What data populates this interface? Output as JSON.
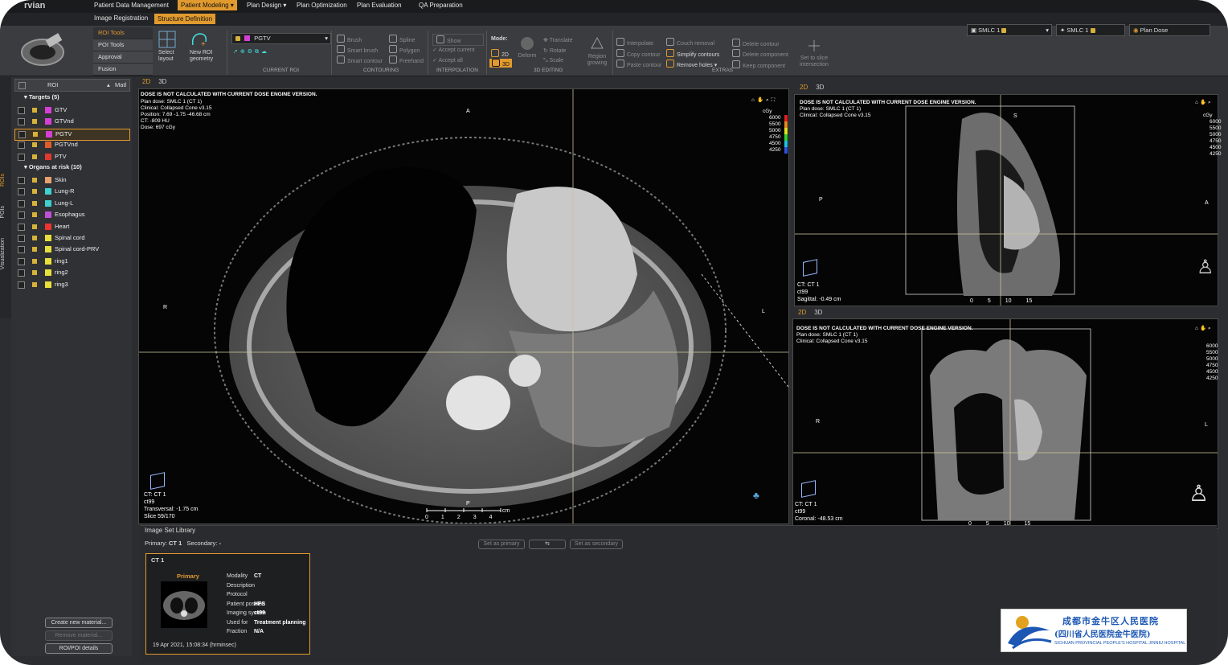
{
  "app": {
    "brand": "rvian"
  },
  "menu": {
    "tabs": [
      "Patient Data Management",
      "Patient Modeling ▾",
      "Plan Design ▾",
      "Plan Optimization",
      "Plan Evaluation",
      "QA Preparation"
    ]
  },
  "submenu": {
    "tabs": [
      "Image Registration",
      "Structure Definition"
    ]
  },
  "ribbon": {
    "side_menu": [
      "ROI Tools",
      "POI Tools",
      "Approval",
      "Fusion"
    ],
    "select_layout": "Select layout",
    "new_roi": "New ROI geometry",
    "current_roi": {
      "name": "PGTV",
      "color": "#d53fd5",
      "group_label": "CURRENT ROI"
    },
    "contouring": {
      "tools": [
        "Brush",
        "Smart brush",
        "Smart contour",
        "Spline",
        "Polygon",
        "Freehand"
      ],
      "group_label": "CONTOURING"
    },
    "interpolation": {
      "show": "Show",
      "accept_current": "Accept current",
      "accept_all": "Accept all",
      "group_label": "INTERPOLATION"
    },
    "mode": {
      "label": "Mode:",
      "options": [
        "2D",
        "3D"
      ]
    },
    "editing_3d": {
      "deform": "Deform",
      "translate": "Translate",
      "rotate": "Rotate",
      "scale": "Scale",
      "region_growing": "Region growing",
      "group_label": "3D EDITING"
    },
    "extras": {
      "interpolate": "Interpolate",
      "copy_contour": "Copy contour",
      "paste_contour": "Paste contour",
      "couch_removal": "Couch removal",
      "simplify_contours": "Simplify contours",
      "remove_holes": "Remove holes ▾",
      "delete_contour": "Delete contour",
      "delete_component": "Delete component",
      "keep_component": "Keep component",
      "set_to_slice": "Set to slice intersection",
      "group_label": "EXTRAS"
    },
    "status": {
      "plan1": "SMLC 1",
      "plan2": "SMLC 1",
      "plan_dose": "Plan Dose"
    }
  },
  "left_panel": {
    "vtabs": [
      "ROIs",
      "POIs",
      "Visualization"
    ],
    "header": {
      "roi": "ROI",
      "matl": "Matl"
    },
    "groups": [
      {
        "label": "Targets (5)",
        "items": [
          {
            "name": "GTV",
            "color": "#d53fd5"
          },
          {
            "name": "GTVnd",
            "color": "#d53fd5"
          },
          {
            "name": "PGTV",
            "color": "#d53fd5",
            "selected": true
          },
          {
            "name": "PGTVnd",
            "color": "#e25c2b"
          },
          {
            "name": "PTV",
            "color": "#e03a2f"
          }
        ]
      },
      {
        "label": "Organs at risk (10)",
        "items": [
          {
            "name": "Skin",
            "color": "#e8a070"
          },
          {
            "name": "Lung-R",
            "color": "#3fd0d0"
          },
          {
            "name": "Lung-L",
            "color": "#3fd0d0"
          },
          {
            "name": "Esophagus",
            "color": "#c04fd8"
          },
          {
            "name": "Heart",
            "color": "#e33"
          },
          {
            "name": "Spinal cord",
            "color": "#e8e03a"
          },
          {
            "name": "Spinal cord-PRV",
            "color": "#e8e03a"
          },
          {
            "name": "ring1",
            "color": "#e8e03a"
          },
          {
            "name": "ring2",
            "color": "#e8e03a"
          },
          {
            "name": "ring3",
            "color": "#e8e03a"
          }
        ]
      }
    ],
    "buttons": [
      "Create new material...",
      "Remove material...",
      "ROI/POI details"
    ]
  },
  "viewports": {
    "tabs": [
      "2D",
      "3D"
    ],
    "main": {
      "warning": "DOSE IS NOT CALCULATED WITH CURRENT DOSE ENGINE VERSION.",
      "lines": [
        "Plan dose: SMLC 1 (CT 1)",
        "Clinical: Collapsed Cone v3.15",
        "Position: 7.69 -1.75 -46.68 cm",
        "CT: -809 HU",
        "Dose: 697 cGy"
      ],
      "bottom": [
        "CT: CT 1",
        "ct99",
        "Transversal: -1.75 cm",
        "Slice 59/170"
      ],
      "orient": {
        "top": "A",
        "bottom": "P",
        "left": "R",
        "right": "L"
      },
      "scale": [
        "0",
        "1",
        "2",
        "3",
        "4"
      ],
      "scale_unit": "cm"
    },
    "sagittal": {
      "warning": "DOSE IS NOT CALCULATED WITH CURRENT DOSE ENGINE VERSION.",
      "lines": [
        "Plan dose: SMLC 1 (CT 1)",
        "Clinical: Collapsed Cone v3.15"
      ],
      "bottom": [
        "CT: CT 1",
        "ct99",
        "Sagittal: -0.49 cm"
      ],
      "orient": {
        "left": "P",
        "right": "A",
        "top": "S"
      },
      "scale": [
        "0",
        "5",
        "10",
        "15"
      ]
    },
    "coronal": {
      "warning": "DOSE IS NOT CALCULATED WITH CURRENT DOSE ENGINE VERSION.",
      "lines": [
        "Plan dose: SMLC 1 (CT 1)",
        "Clinical: Collapsed Cone v3.15"
      ],
      "bottom": [
        "CT: CT 1",
        "ct99",
        "Coronal: -48.53 cm"
      ],
      "orient": {
        "left": "R",
        "right": "L"
      },
      "scale": [
        "0",
        "5",
        "10",
        "15"
      ]
    },
    "colorbar": {
      "unit": "cGy",
      "levels": [
        "6000",
        "5500",
        "5000",
        "4750",
        "4500",
        "4250"
      ],
      "colors": [
        "#e02020",
        "#e08a20",
        "#e0e020",
        "#30d030",
        "#20c0e0",
        "#3050e0"
      ]
    }
  },
  "library": {
    "title": "Image Set Library",
    "primary_label": "Primary:",
    "primary_value": "CT 1",
    "secondary_label": "Secondary:",
    "secondary_value": "-",
    "buttons": [
      "Set as primary",
      "⇆",
      "Set as secondary"
    ],
    "card": {
      "title": "CT 1",
      "role": "Primary",
      "fields": [
        {
          "k": "Modality",
          "v": "CT"
        },
        {
          "k": "Description",
          "v": ""
        },
        {
          "k": "Protocol",
          "v": ""
        },
        {
          "k": "Patient position",
          "v": "HFS"
        },
        {
          "k": "Imaging system",
          "v": "ct99"
        },
        {
          "k": "Used for",
          "v": "Treatment planning"
        },
        {
          "k": "Fraction",
          "v": "N/A"
        }
      ],
      "date": "19 Apr 2021, 15:08:34 (hrminsec)"
    }
  },
  "watermark": {
    "cn1": "成都市金牛区人民医院",
    "cn2": "(四川省人民医院金牛医院)",
    "en": "SICHUAN PROVINCIAL PEOPLE'S HOSPITAL JINNIU HOSPITAL"
  }
}
